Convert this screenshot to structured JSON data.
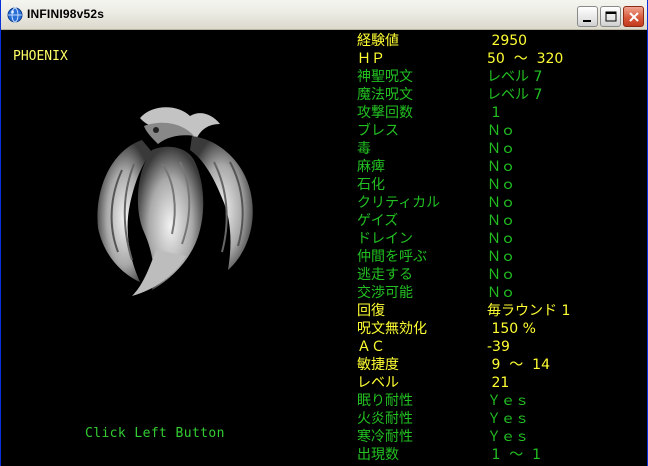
{
  "window": {
    "title": "INFINI98v52s",
    "app_icon": "globe-icon",
    "controls": [
      "minimize-icon",
      "maximize-icon",
      "close-icon"
    ]
  },
  "monster": {
    "name": "PHOENIX",
    "image": "phoenix-sprite"
  },
  "hint": "Click Left Button",
  "colors": {
    "highlight": "#ffff33",
    "normal": "#22c022",
    "background": "#000000"
  },
  "stats": [
    {
      "label": "経験値",
      "value": " 2950",
      "color": "yellow"
    },
    {
      "label": "ＨＰ",
      "value": "50  ～  320",
      "color": "yellow"
    },
    {
      "label": "神聖呪文",
      "value": "レベル 7",
      "color": "green"
    },
    {
      "label": "魔法呪文",
      "value": "レベル 7",
      "color": "green"
    },
    {
      "label": "攻撃回数",
      "value": " 1",
      "color": "green"
    },
    {
      "label": "ブレス",
      "value": "Ｎｏ",
      "color": "green"
    },
    {
      "label": "毒",
      "value": "Ｎｏ",
      "color": "green"
    },
    {
      "label": "麻痺",
      "value": "Ｎｏ",
      "color": "green"
    },
    {
      "label": "石化",
      "value": "Ｎｏ",
      "color": "green"
    },
    {
      "label": "クリティカル",
      "value": "Ｎｏ",
      "color": "green"
    },
    {
      "label": "ゲイズ",
      "value": "Ｎｏ",
      "color": "green"
    },
    {
      "label": "ドレイン",
      "value": "Ｎｏ",
      "color": "green"
    },
    {
      "label": "仲間を呼ぶ",
      "value": "Ｎｏ",
      "color": "green"
    },
    {
      "label": "逃走する",
      "value": "Ｎｏ",
      "color": "green"
    },
    {
      "label": "交渉可能",
      "value": "Ｎｏ",
      "color": "green"
    },
    {
      "label": "回復",
      "value": "毎ラウンド 1",
      "color": "yellow"
    },
    {
      "label": "呪文無効化",
      "value": " 150 %",
      "color": "yellow"
    },
    {
      "label": "ＡＣ",
      "value": "-39",
      "color": "yellow"
    },
    {
      "label": "敏捷度",
      "value": " 9  ～  14",
      "color": "yellow"
    },
    {
      "label": "レベル",
      "value": " 21",
      "color": "yellow"
    },
    {
      "label": "眠り耐性",
      "value": "Ｙｅｓ",
      "color": "green"
    },
    {
      "label": "火炎耐性",
      "value": "Ｙｅｓ",
      "color": "green"
    },
    {
      "label": "寒冷耐性",
      "value": "Ｙｅｓ",
      "color": "green"
    },
    {
      "label": "出現数",
      "value": " 1  ～  1",
      "color": "green"
    }
  ]
}
